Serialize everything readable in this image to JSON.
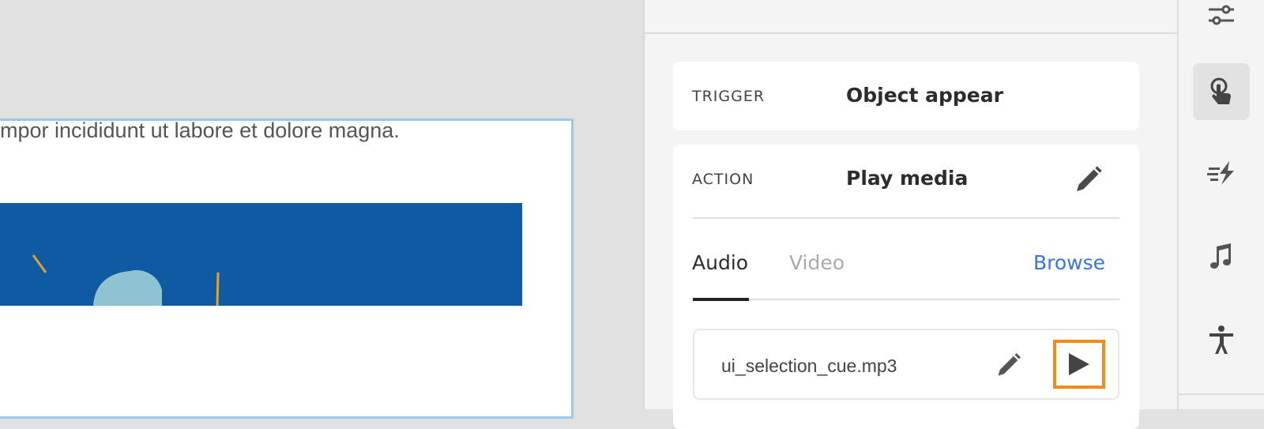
{
  "canvas": {
    "body_text": "mpor incididunt ut labore et dolore magna."
  },
  "panel": {
    "trigger": {
      "label": "TRIGGER",
      "value": "Object appear"
    },
    "action": {
      "label": "ACTION",
      "value": "Play media"
    },
    "tabs": [
      {
        "label": "Audio",
        "active": true
      },
      {
        "label": "Video",
        "active": false
      }
    ],
    "browse_label": "Browse",
    "file": {
      "name": "ui_selection_cue.mp3"
    }
  },
  "colors": {
    "accent": "#3b73e0",
    "focus": "#f28c18",
    "image_bg": "#0e5aa3"
  },
  "rail": {
    "icons": [
      "sliders-icon",
      "touch-icon",
      "animation-icon",
      "music-icon",
      "accessibility-icon"
    ]
  }
}
